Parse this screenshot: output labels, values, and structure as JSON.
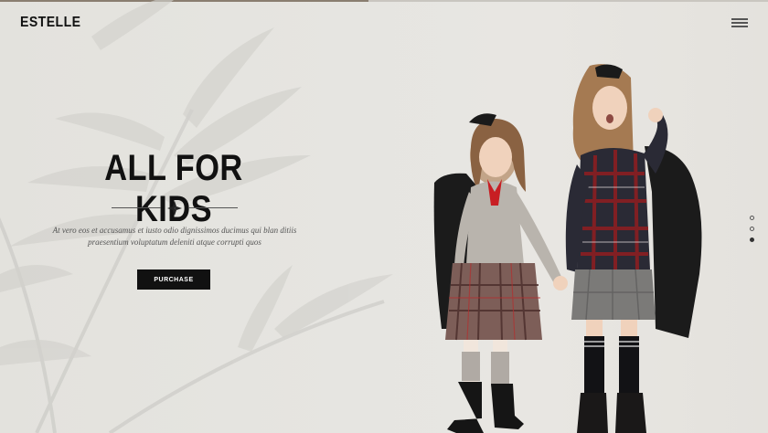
{
  "header": {
    "logo": "ESTELLE",
    "menu_icon": "hamburger-menu-icon"
  },
  "hero": {
    "title": "ALL FOR KIDS",
    "divider_icon": "ornament-icon",
    "subtitle_line1": "At vero eos et accusamus et iusto odio dignissimos ducimus qui blan ditiis",
    "subtitle_line2": "praesentium voluptatum deleniti atque corrupti quos",
    "cta_label": "PURCHASE",
    "image": "two-girls-in-school-uniforms-photo"
  },
  "slider": {
    "count": 3,
    "active_index": 2
  },
  "colors": {
    "background": "#e6e5e1",
    "text": "#111111",
    "button_bg": "#111111",
    "button_text": "#ffffff",
    "plaid_red": "#8b1e22",
    "sweater_grey": "#b5b0aa"
  }
}
